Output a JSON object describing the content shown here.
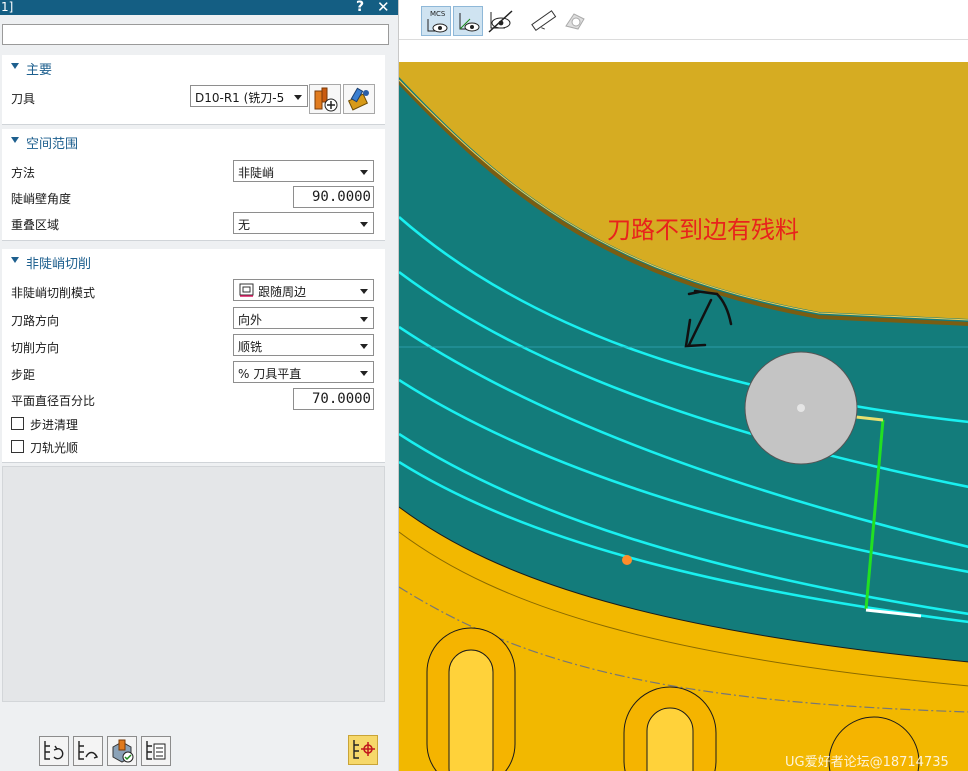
{
  "dialog": {
    "title": "1]",
    "help_label": "?",
    "close_label": "✕",
    "top_field_value": ""
  },
  "main": {
    "section_title": "主要",
    "tool_label": "刀具",
    "tool_value": "D10-R1 (铣刀-5"
  },
  "spatial": {
    "section_title": "空间范围",
    "method_label": "方法",
    "method_value": "非陡峭",
    "steep_angle_label": "陡峭壁角度",
    "steep_angle_value": "90.0000",
    "overlap_label": "重叠区域",
    "overlap_value": "无"
  },
  "nonsteep": {
    "section_title": "非陡峭切削",
    "pattern_label": "非陡峭切削模式",
    "pattern_value": "跟随周边",
    "direction_label": "刀路方向",
    "direction_value": "向外",
    "cut_dir_label": "切削方向",
    "cut_dir_value": "顺铣",
    "stepover_label": "步距",
    "stepover_value": "% 刀具平直",
    "percent_label": "平面直径百分比",
    "percent_value": "70.0000",
    "step_clean_label": "步进清理",
    "step_clean_checked": false,
    "smooth_label": "刀轨光顺",
    "smooth_checked": false
  },
  "viewport": {
    "mcs_label": "MCS",
    "annotation": "刀路不到边有残料",
    "watermark": "UG爱好者论坛@18714735",
    "colors": {
      "teal_surface": "#137c7b",
      "gold_surface": "#d6ac22",
      "toolpath": "#19f0f0",
      "tool_disc": "#c4c4c4",
      "annotation": "#e8231c"
    }
  },
  "icons": [
    "mcs-eye-icon",
    "wcs-eye-icon",
    "hide-eye-icon",
    "measure-ruler-icon",
    "shape-icon",
    "tool-new-icon",
    "tool-edit-icon",
    "generate-path-icon",
    "replay-path-icon",
    "verify-path-icon",
    "list-path-icon",
    "display-toggle-icon"
  ]
}
